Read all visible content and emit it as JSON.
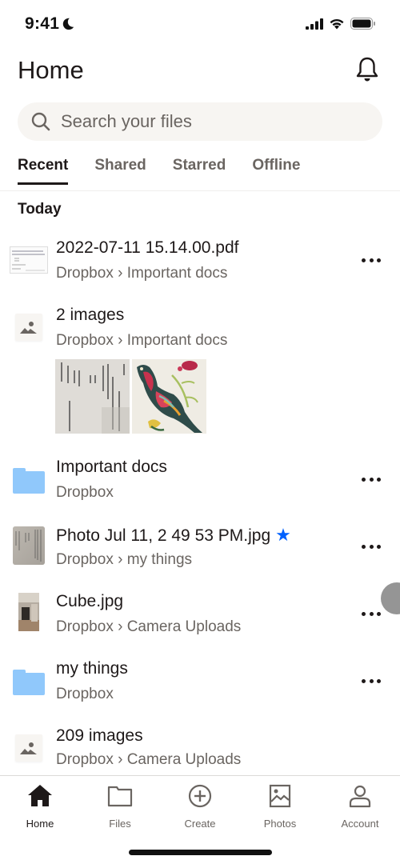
{
  "status_bar": {
    "time": "9:41",
    "focus_icon": "moon-icon",
    "icons": [
      "signal-icon",
      "wifi-icon",
      "battery-icon"
    ]
  },
  "header": {
    "title": "Home",
    "notification_icon": "bell-icon"
  },
  "search": {
    "placeholder": "Search your files",
    "value": ""
  },
  "tabs": [
    {
      "label": "Recent",
      "active": true
    },
    {
      "label": "Shared",
      "active": false
    },
    {
      "label": "Starred",
      "active": false
    },
    {
      "label": "Offline",
      "active": false
    }
  ],
  "section": {
    "title": "Today"
  },
  "items": [
    {
      "name": "2022-07-11 15.14.00.pdf",
      "path": "Dropbox › Important docs",
      "type": "pdf",
      "icon": "pdf-thumbnail",
      "has_menu": true,
      "starred": false
    },
    {
      "name": "2 images",
      "path": "Dropbox › Important docs",
      "type": "image-group",
      "icon": "image-icon",
      "has_menu": false,
      "starred": false,
      "previews": [
        "receipt-photo",
        "bird-embroidery-photo"
      ]
    },
    {
      "name": "Important docs",
      "path": "Dropbox",
      "type": "folder",
      "icon": "folder-icon",
      "has_menu": true,
      "starred": false
    },
    {
      "name": "Photo Jul 11, 2 49 53 PM.jpg",
      "path": "Dropbox › my things",
      "type": "image",
      "icon": "photo-thumbnail",
      "has_menu": true,
      "starred": true
    },
    {
      "name": "Cube.jpg",
      "path": "Dropbox › Camera Uploads",
      "type": "image",
      "icon": "photo-thumbnail",
      "has_menu": true,
      "starred": false
    },
    {
      "name": "my things",
      "path": "Dropbox",
      "type": "folder",
      "icon": "folder-icon",
      "has_menu": true,
      "starred": false
    },
    {
      "name": "209 images",
      "path": "Dropbox › Camera Uploads",
      "type": "image-group",
      "icon": "image-icon",
      "has_menu": false,
      "starred": false
    }
  ],
  "bottom_nav": [
    {
      "label": "Home",
      "icon": "home-icon",
      "active": true
    },
    {
      "label": "Files",
      "icon": "folder-icon",
      "active": false
    },
    {
      "label": "Create",
      "icon": "plus-circle-icon",
      "active": false
    },
    {
      "label": "Photos",
      "icon": "photo-icon",
      "active": false
    },
    {
      "label": "Account",
      "icon": "person-icon",
      "active": false
    }
  ],
  "colors": {
    "text_primary": "#1e1919",
    "text_secondary": "#6a6561",
    "accent_star": "#0061fe",
    "folder": "#90c8fb",
    "search_bg": "#f7f5f2"
  }
}
